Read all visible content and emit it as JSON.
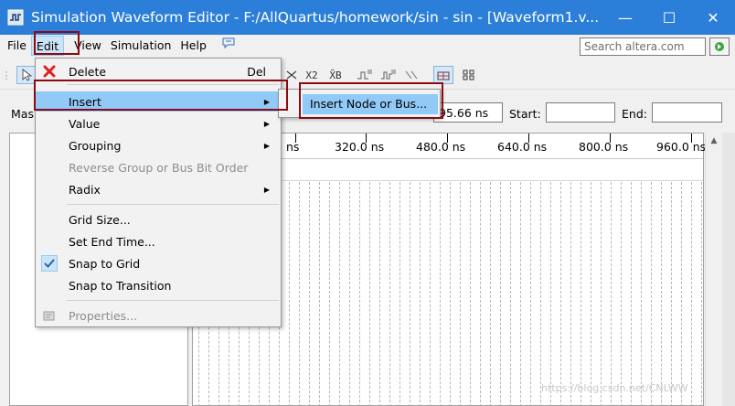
{
  "window": {
    "title": "Simulation Waveform Editor - F:/AllQuartus/homework/sin - sin - [Waveform1.v...",
    "minimize_glyph": "—",
    "maximize_glyph": "☐",
    "close_glyph": "✕"
  },
  "menubar": {
    "items": [
      "File",
      "Edit",
      "View",
      "Simulation",
      "Help"
    ],
    "search_placeholder": "Search altera.com"
  },
  "toolbar": {
    "icon_labels": [
      "X2",
      "X̄B"
    ]
  },
  "master": {
    "label": "Mas",
    "time_value": "95.66 ns",
    "start_label": "Start:",
    "start_value": "",
    "end_label": "End:",
    "end_value": ""
  },
  "timeline": {
    "ticks": [
      "ns",
      "320.0 ns",
      "480.0 ns",
      "640.0 ns",
      "800.0 ns",
      "960.0 ns"
    ]
  },
  "edit_menu": {
    "delete_label": "Delete",
    "delete_shortcut": "Del",
    "insert_label": "Insert",
    "value_label": "Value",
    "grouping_label": "Grouping",
    "reverse_group_label": "Reverse Group or Bus Bit Order",
    "radix_label": "Radix",
    "grid_size_label": "Grid Size...",
    "set_end_time_label": "Set End Time...",
    "snap_to_grid_label": "Snap to Grid",
    "snap_to_transition_label": "Snap to Transition",
    "properties_label": "Properties..."
  },
  "insert_submenu": {
    "insert_node_label": "Insert Node or Bus..."
  },
  "watermark": "https://blog.csdn.net/CNLWW",
  "colors": {
    "titlebar": "#2b7fd9",
    "highlight": "#91c9f7",
    "annotation": "#8b0a14"
  }
}
